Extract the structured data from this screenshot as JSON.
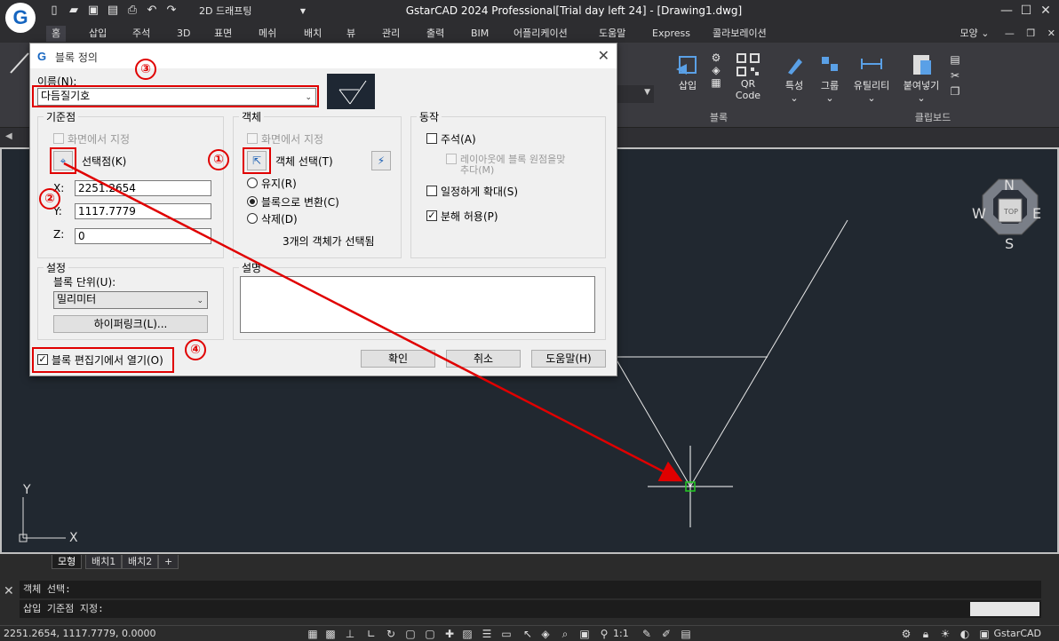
{
  "titlebar": {
    "title": "GstarCAD 2024 Professional[Trial day left 24] - [Drawing1.dwg]",
    "workspace": "2D 드래프팅"
  },
  "ribbon": {
    "tabs": [
      "홈",
      "삽입",
      "주석",
      "3D",
      "표면",
      "메쉬",
      "배치",
      "뷰",
      "관리",
      "출력",
      "BIM",
      "어플리케이션",
      "도움말",
      "Express",
      "콜라보레이션"
    ],
    "right_label": "모양",
    "buttons": {
      "insert": "삽입",
      "qr": "QR Code",
      "properties": "특성",
      "group": "그룹",
      "utilities": "유틸리티",
      "paste": "붙여넣기"
    },
    "group_labels": {
      "block": "블록",
      "clipboard": "클립보드"
    }
  },
  "viewcube": {
    "north": "N",
    "south": "S",
    "east": "E",
    "west": "W",
    "top": "TOP"
  },
  "ucs": {
    "x": "X",
    "y": "Y"
  },
  "layout_tabs": [
    "모형",
    "배치1",
    "배치2",
    "+"
  ],
  "command": {
    "line1": "객체 선택:",
    "line2": "삽입 기준점 지정:"
  },
  "status": {
    "coords": "2251.2654, 1117.7779, 0.0000",
    "scale": "1:1",
    "brand": "GstarCAD"
  },
  "dialog": {
    "title": "블록 정의",
    "name_label": "이름(N):",
    "name_value": "다듬질기호",
    "base": {
      "title": "기준점",
      "on_screen": "화면에서 지정",
      "pick_point": "선택점(K)",
      "x_label": "X:",
      "x_value": "2251.2654",
      "y_label": "Y:",
      "y_value": "1117.7779",
      "z_label": "Z:",
      "z_value": "0"
    },
    "objects": {
      "title": "객체",
      "on_screen": "화면에서 지정",
      "select": "객체 선택(T)",
      "retain": "유지(R)",
      "convert": "블록으로 변환(C)",
      "delete": "삭제(D)",
      "count_text": "3개의 객체가 선택됨"
    },
    "behavior": {
      "title": "동작",
      "annotative": "주석(A)",
      "match_layout_1": "레이아웃에 블록 원점을맞",
      "match_layout_2": "추다(M)",
      "uniform": "일정하게 확대(S)",
      "explode": "분해 허용(P)"
    },
    "settings": {
      "title": "설정",
      "unit_label": "블록 단위(U):",
      "unit_value": "밀리미터",
      "hyperlink": "하이퍼링크(L)..."
    },
    "description": {
      "title": "설명",
      "value": ""
    },
    "open_editor": "블록 편집기에서 열기(O)",
    "ok": "확인",
    "cancel": "취소",
    "help": "도움말(H)"
  },
  "markers": {
    "m1": "①",
    "m2": "②",
    "m3": "③",
    "m4": "④"
  }
}
